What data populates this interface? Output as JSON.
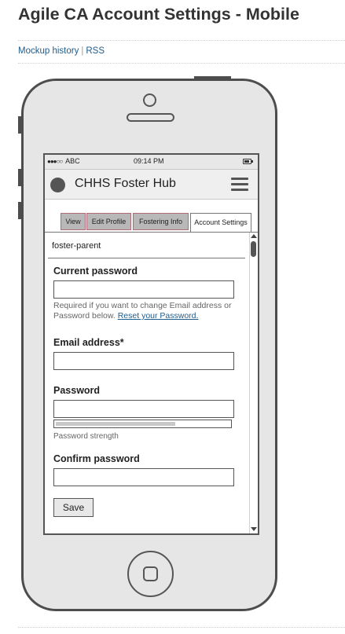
{
  "page": {
    "title": "Agile CA Account Settings - Mobile",
    "links": {
      "history": "Mockup history",
      "separator": "|",
      "rss": "RSS"
    }
  },
  "status_bar": {
    "carrier_dots": "●●●○○",
    "carrier": "ABC",
    "time": "09:14 PM"
  },
  "app": {
    "name": "CHHS Foster Hub"
  },
  "tabs": [
    {
      "label": "View"
    },
    {
      "label": "Edit Profile"
    },
    {
      "label": "Fostering Info"
    },
    {
      "label": "Account Settings",
      "active": true
    }
  ],
  "form": {
    "username": "foster-parent",
    "current_password": {
      "label": "Current password",
      "value": ""
    },
    "help_text": "Required if you want to change Email address or Password below.",
    "reset_link": "Reset your Password.",
    "email": {
      "label": "Email address*",
      "value": ""
    },
    "password": {
      "label": "Password",
      "value": ""
    },
    "strength_label": "Password strength",
    "confirm_password": {
      "label": "Confirm password",
      "value": ""
    },
    "save_label": "Save"
  },
  "colors": {
    "tab_border": "#b06a7a",
    "tab_inactive": "#b8b8b8",
    "link": "#1d5c8e"
  },
  "icons": [
    "battery-icon",
    "app-logo-icon",
    "hamburger-menu-icon",
    "scroll-up-arrow-icon",
    "scroll-down-arrow-icon",
    "home-button-icon"
  ]
}
